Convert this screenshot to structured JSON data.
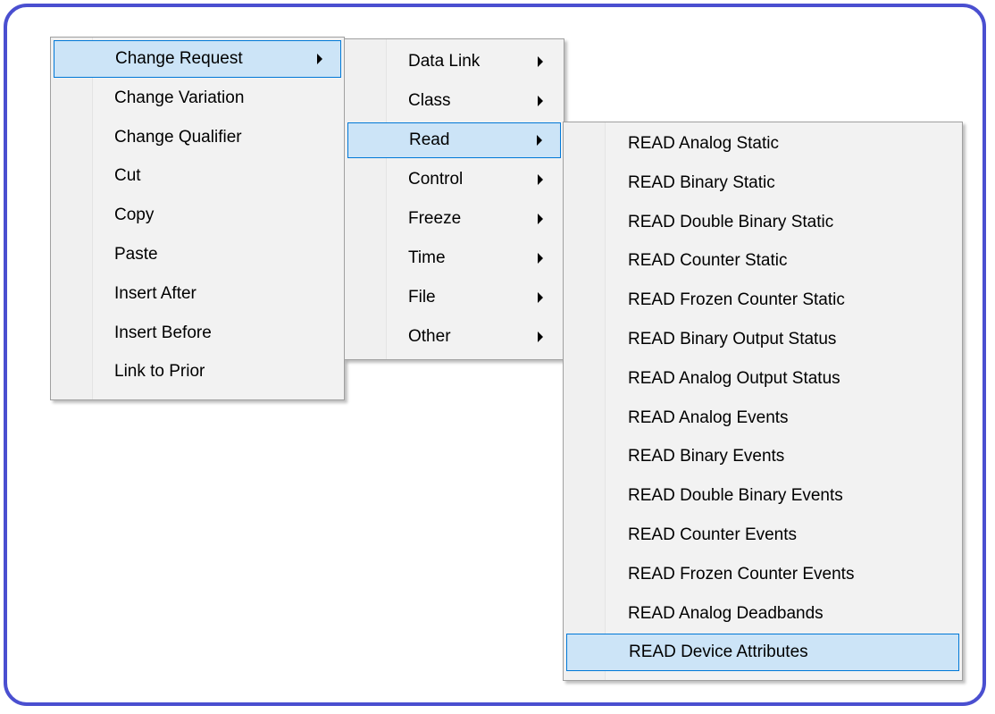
{
  "colors": {
    "frame_border": "#4a4fd0",
    "menu_background": "#f2f2f2",
    "selection_fill": "#cce4f7",
    "selection_border": "#0078d7"
  },
  "menu_main": {
    "items": [
      {
        "label": "Change Request",
        "submenu": true,
        "selected": true
      },
      {
        "label": "Change Variation",
        "submenu": false
      },
      {
        "label": "Change Qualifier",
        "submenu": false
      },
      {
        "label": "Cut",
        "submenu": false
      },
      {
        "label": "Copy",
        "submenu": false
      },
      {
        "label": "Paste",
        "submenu": false
      },
      {
        "label": "Insert After",
        "submenu": false
      },
      {
        "label": "Insert Before",
        "submenu": false
      },
      {
        "label": "Link to Prior",
        "submenu": false
      }
    ]
  },
  "menu_change_request": {
    "items": [
      {
        "label": "Data Link",
        "submenu": true
      },
      {
        "label": "Class",
        "submenu": true
      },
      {
        "label": "Read",
        "submenu": true,
        "selected": true
      },
      {
        "label": "Control",
        "submenu": true
      },
      {
        "label": "Freeze",
        "submenu": true
      },
      {
        "label": "Time",
        "submenu": true
      },
      {
        "label": "File",
        "submenu": true
      },
      {
        "label": "Other",
        "submenu": true
      }
    ]
  },
  "menu_read": {
    "items": [
      {
        "label": "READ Analog Static"
      },
      {
        "label": "READ Binary Static"
      },
      {
        "label": "READ Double Binary Static"
      },
      {
        "label": "READ Counter Static"
      },
      {
        "label": "READ Frozen Counter Static"
      },
      {
        "label": "READ Binary Output Status"
      },
      {
        "label": "READ Analog Output Status"
      },
      {
        "label": "READ Analog Events"
      },
      {
        "label": "READ Binary Events"
      },
      {
        "label": "READ Double Binary Events"
      },
      {
        "label": "READ Counter Events"
      },
      {
        "label": "READ Frozen Counter Events"
      },
      {
        "label": "READ Analog Deadbands"
      },
      {
        "label": "READ Device Attributes",
        "selected": true
      }
    ]
  }
}
